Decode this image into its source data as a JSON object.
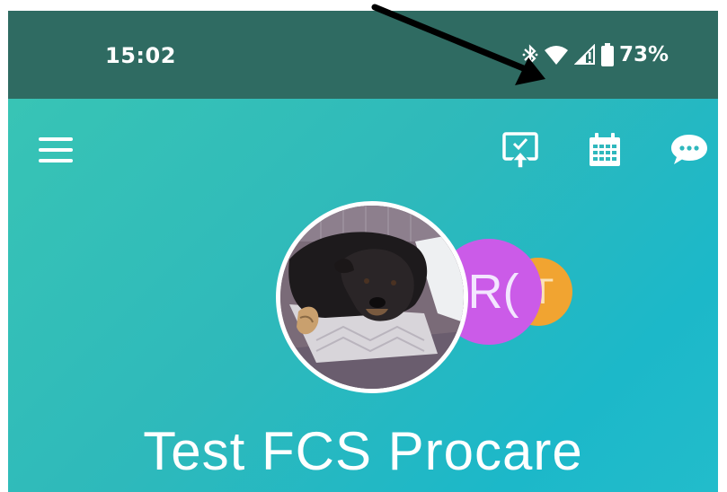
{
  "status_bar": {
    "time": "15:02",
    "battery_percent": "73%",
    "icons": [
      "bluetooth-icon",
      "wifi-icon",
      "signal-icon",
      "battery-icon"
    ]
  },
  "toolbar": {
    "menu_icon": "hamburger-menu-icon",
    "actions": [
      "check-in-icon",
      "calendar-icon",
      "messages-icon"
    ]
  },
  "profile": {
    "name": "Test FCS Procare",
    "avatars": [
      {
        "type": "photo",
        "description_icon": "dog-photo"
      },
      {
        "type": "initials",
        "text": "R(",
        "color": "#cb5be8"
      },
      {
        "type": "initials",
        "text": "T",
        "color": "#f1a431"
      }
    ]
  },
  "colors": {
    "status_bar": "#2f6b62",
    "header_gradient_start": "#38c4b5",
    "header_gradient_end": "#1cb8c9",
    "arrow": "#000000"
  }
}
